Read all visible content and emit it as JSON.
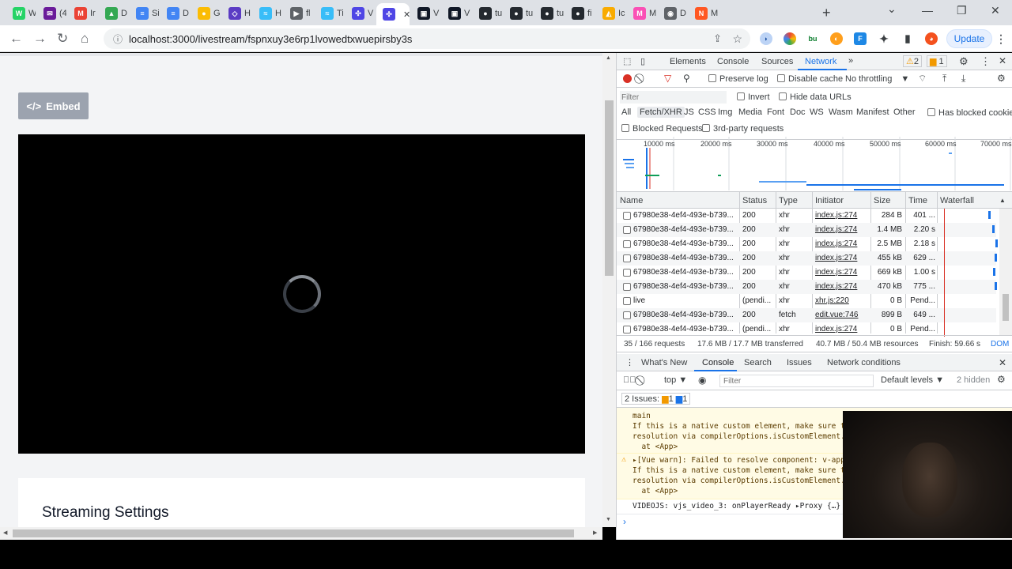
{
  "browser": {
    "tabs": [
      {
        "label": "W",
        "icon": "whatsapp-icon",
        "color": "#25d366",
        "glyph": "W"
      },
      {
        "label": "(4",
        "icon": "mail-icon",
        "color": "#6a1b9a",
        "glyph": "✉"
      },
      {
        "label": "Ir",
        "icon": "gmail-icon",
        "color": "#ea4335",
        "glyph": "M"
      },
      {
        "label": "D",
        "icon": "drive-icon",
        "color": "#34a853",
        "glyph": "▲"
      },
      {
        "label": "Si",
        "icon": "docs-icon",
        "color": "#4285f4",
        "glyph": "≡"
      },
      {
        "label": "D",
        "icon": "docs-icon",
        "color": "#4285f4",
        "glyph": "≡"
      },
      {
        "label": "G",
        "icon": "keep-icon",
        "color": "#fbbc04",
        "glyph": "●"
      },
      {
        "label": "H",
        "icon": "shield-icon",
        "color": "#5b3cc4",
        "glyph": "◇"
      },
      {
        "label": "H",
        "icon": "tailwind-icon",
        "color": "#38bdf8",
        "glyph": "≈"
      },
      {
        "label": "fl",
        "icon": "play-icon",
        "color": "#5f6368",
        "glyph": "▶"
      },
      {
        "label": "Ti",
        "icon": "tailwind-icon",
        "color": "#38bdf8",
        "glyph": "≈"
      },
      {
        "label": "V",
        "icon": "component-icon",
        "color": "#4f46e5",
        "glyph": "✣"
      },
      {
        "label": "",
        "icon": "component-icon",
        "color": "#4f46e5",
        "glyph": "✣",
        "active": true
      },
      {
        "label": "V",
        "icon": "screen-icon",
        "color": "#111827",
        "glyph": "▣"
      },
      {
        "label": "V",
        "icon": "screen-icon",
        "color": "#111827",
        "glyph": "▣"
      },
      {
        "label": "tu",
        "icon": "github-icon",
        "color": "#24292f",
        "glyph": "●"
      },
      {
        "label": "tu",
        "icon": "github-icon",
        "color": "#24292f",
        "glyph": "●"
      },
      {
        "label": "tu",
        "icon": "github-icon",
        "color": "#24292f",
        "glyph": "●"
      },
      {
        "label": "fi",
        "icon": "github-icon",
        "color": "#24292f",
        "glyph": "●"
      },
      {
        "label": "Ic",
        "icon": "chart-icon",
        "color": "#f9ab00",
        "glyph": "◭"
      },
      {
        "label": "M",
        "icon": "mux-icon",
        "color": "#fa50b5",
        "glyph": "M"
      },
      {
        "label": "D",
        "icon": "chrome-icon",
        "color": "#5f6368",
        "glyph": "◉"
      },
      {
        "label": "M",
        "icon": "wave-icon",
        "color": "#ff5722",
        "glyph": "N"
      }
    ],
    "url": "localhost:3000/livestream/fspnxuy3e6rp1lvowedtxwuepirsby3s",
    "update_label": "Update"
  },
  "page": {
    "embed_label": "Embed",
    "settings_title": "Streaming Settings"
  },
  "devtools": {
    "tabs": [
      "Elements",
      "Console",
      "Sources",
      "Network"
    ],
    "selected_tab": "Network",
    "warnings_count": "2",
    "issues_count": "1",
    "toolbar": {
      "preserve_log": "Preserve log",
      "disable_cache": "Disable cache",
      "throttling": "No throttling"
    },
    "filter_placeholder": "Filter",
    "invert": "Invert",
    "hide_data_urls": "Hide data URLs",
    "type_filters": [
      "All",
      "Fetch/XHR",
      "JS",
      "CSS",
      "Img",
      "Media",
      "Font",
      "Doc",
      "WS",
      "Wasm",
      "Manifest",
      "Other"
    ],
    "selected_type": "Fetch/XHR",
    "has_blocked_cookies": "Has blocked cookies",
    "blocked_requests": "Blocked Requests",
    "third_party": "3rd-party requests",
    "timeline_labels": [
      "10000 ms",
      "20000 ms",
      "30000 ms",
      "40000 ms",
      "50000 ms",
      "60000 ms",
      "70000 ms"
    ],
    "columns": [
      "Name",
      "Status",
      "Type",
      "Initiator",
      "Size",
      "Time",
      "Waterfall"
    ],
    "rows": [
      {
        "name": "67980e38-4ef4-493e-b739...",
        "status": "200",
        "type": "xhr",
        "initiator": "index.js:274",
        "size": "284 B",
        "time": "401 ..."
      },
      {
        "name": "67980e38-4ef4-493e-b739...",
        "status": "200",
        "type": "xhr",
        "initiator": "index.js:274",
        "size": "1.4 MB",
        "time": "2.20 s"
      },
      {
        "name": "67980e38-4ef4-493e-b739...",
        "status": "200",
        "type": "xhr",
        "initiator": "index.js:274",
        "size": "2.5 MB",
        "time": "2.18 s"
      },
      {
        "name": "67980e38-4ef4-493e-b739...",
        "status": "200",
        "type": "xhr",
        "initiator": "index.js:274",
        "size": "455 kB",
        "time": "629 ..."
      },
      {
        "name": "67980e38-4ef4-493e-b739...",
        "status": "200",
        "type": "xhr",
        "initiator": "index.js:274",
        "size": "669 kB",
        "time": "1.00 s"
      },
      {
        "name": "67980e38-4ef4-493e-b739...",
        "status": "200",
        "type": "xhr",
        "initiator": "index.js:274",
        "size": "470 kB",
        "time": "775 ..."
      },
      {
        "name": "live",
        "status": "(pendi...",
        "type": "xhr",
        "initiator": "xhr.js:220",
        "size": "0 B",
        "time": "Pend..."
      },
      {
        "name": "67980e38-4ef4-493e-b739...",
        "status": "200",
        "type": "fetch",
        "initiator": "edit.vue:746",
        "size": "899 B",
        "time": "649 ..."
      },
      {
        "name": "67980e38-4ef4-493e-b739...",
        "status": "(pendi...",
        "type": "xhr",
        "initiator": "index.js:274",
        "size": "0 B",
        "time": "Pend..."
      }
    ],
    "summary": {
      "requests": "35 / 166 requests",
      "transferred": "17.6 MB / 17.7 MB transferred",
      "resources": "40.7 MB / 50.4 MB resources",
      "finish": "Finish: 59.66 s",
      "dom": "DOM"
    },
    "drawer_tabs": [
      "What's New",
      "Console",
      "Search",
      "Issues",
      "Network conditions"
    ],
    "drawer_selected": "Console",
    "console_context": "top",
    "console_filter_placeholder": "Filter",
    "default_levels": "Default levels",
    "hidden_count": "2 hidden",
    "issues_label": "2 Issues:",
    "issues_warn": "1",
    "issues_info": "1",
    "messages": [
      {
        "lines": [
          "main",
          "If this is a native custom element, make sure to",
          "resolution via compilerOptions.isCustomElement.",
          "  at <App>"
        ]
      },
      {
        "lines": [
          "▸[Vue warn]: Failed to resolve component: v-app",
          "If this is a native custom element, make sure to",
          "resolution via compilerOptions.isCustomElement.",
          "  at <App>"
        ]
      }
    ],
    "log_line": "VIDEOJS: vjs_video_3: onPlayerReady ▸Proxy {…}",
    "prompt": "›"
  }
}
